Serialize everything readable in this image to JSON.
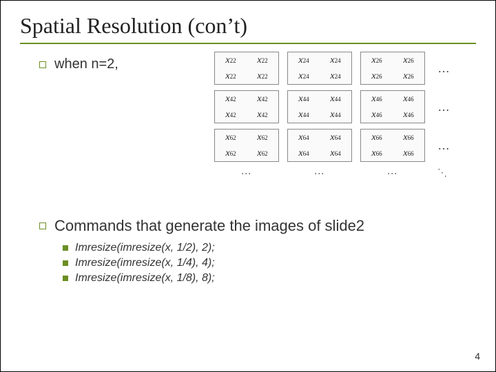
{
  "title": "Spatial Resolution (con’t)",
  "bullets": {
    "when": "when n=2,",
    "commands_head": "Commands that generate the images of slide2",
    "cmds": [
      "Imresize(imresize(x, 1/2), 2);",
      "Imresize(imresize(x, 1/4), 4);",
      "Imresize(imresize(x, 1/8), 8);"
    ]
  },
  "matrix": {
    "blocks": [
      [
        {
          "v": [
            "x22",
            "x22",
            "x22",
            "x22"
          ]
        },
        {
          "v": [
            "x24",
            "x24",
            "x24",
            "x24"
          ]
        },
        {
          "v": [
            "x26",
            "x26",
            "x26",
            "x26"
          ]
        }
      ],
      [
        {
          "v": [
            "x42",
            "x42",
            "x42",
            "x42"
          ]
        },
        {
          "v": [
            "x44",
            "x44",
            "x44",
            "x44"
          ]
        },
        {
          "v": [
            "x46",
            "x46",
            "x46",
            "x46"
          ]
        }
      ],
      [
        {
          "v": [
            "x62",
            "x62",
            "x62",
            "x62"
          ]
        },
        {
          "v": [
            "x64",
            "x64",
            "x64",
            "x64"
          ]
        },
        {
          "v": [
            "x66",
            "x66",
            "x66",
            "x66"
          ]
        }
      ]
    ],
    "hdots": "…",
    "vdots": "⋮",
    "ddots": "⋱"
  },
  "page_number": "4"
}
